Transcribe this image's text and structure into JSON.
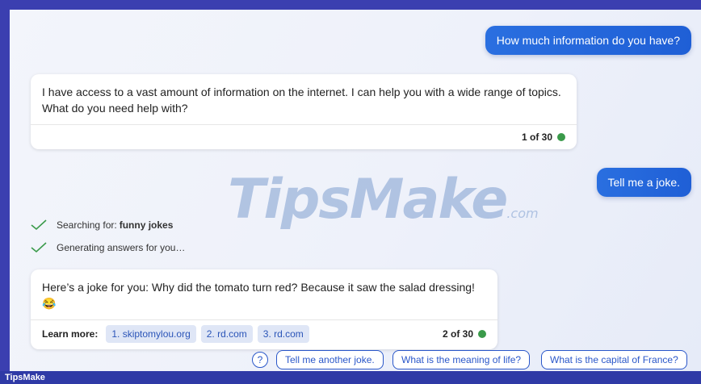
{
  "messages": {
    "user_1": "How much information do you have?",
    "bot_1_text": "I have access to a vast amount of information on the internet. I can help you with a wide range of topics. What do you need help with?",
    "bot_1_counter": "1 of 30",
    "user_2": "Tell me a joke.",
    "status_searching_prefix": "Searching for: ",
    "status_searching_query": "funny jokes",
    "status_generating": "Generating answers for you…",
    "bot_2_text": "Here’s a joke for you: Why did the tomato turn red? Because it saw the salad dressing! 😂",
    "bot_2_learn_more": "Learn more:",
    "bot_2_sources": [
      "1. skiptomylou.org",
      "2. rd.com",
      "3. rd.com"
    ],
    "bot_2_counter": "2 of 30"
  },
  "suggestions": {
    "help_icon": "?",
    "items": [
      "Tell me another joke.",
      "What is the meaning of life?",
      "What is the capital of France?"
    ]
  },
  "watermark": {
    "text": "TipsMake",
    "suffix": ".com"
  },
  "footer": {
    "brand": "TipsMake"
  },
  "colors": {
    "accent": "#2a57c9",
    "user_bubble": "#1f5fd6",
    "status_ok": "#3a9a4a"
  },
  "icons": {
    "check": "check-icon",
    "help": "help-circle-icon",
    "online": "green-dot-icon"
  }
}
